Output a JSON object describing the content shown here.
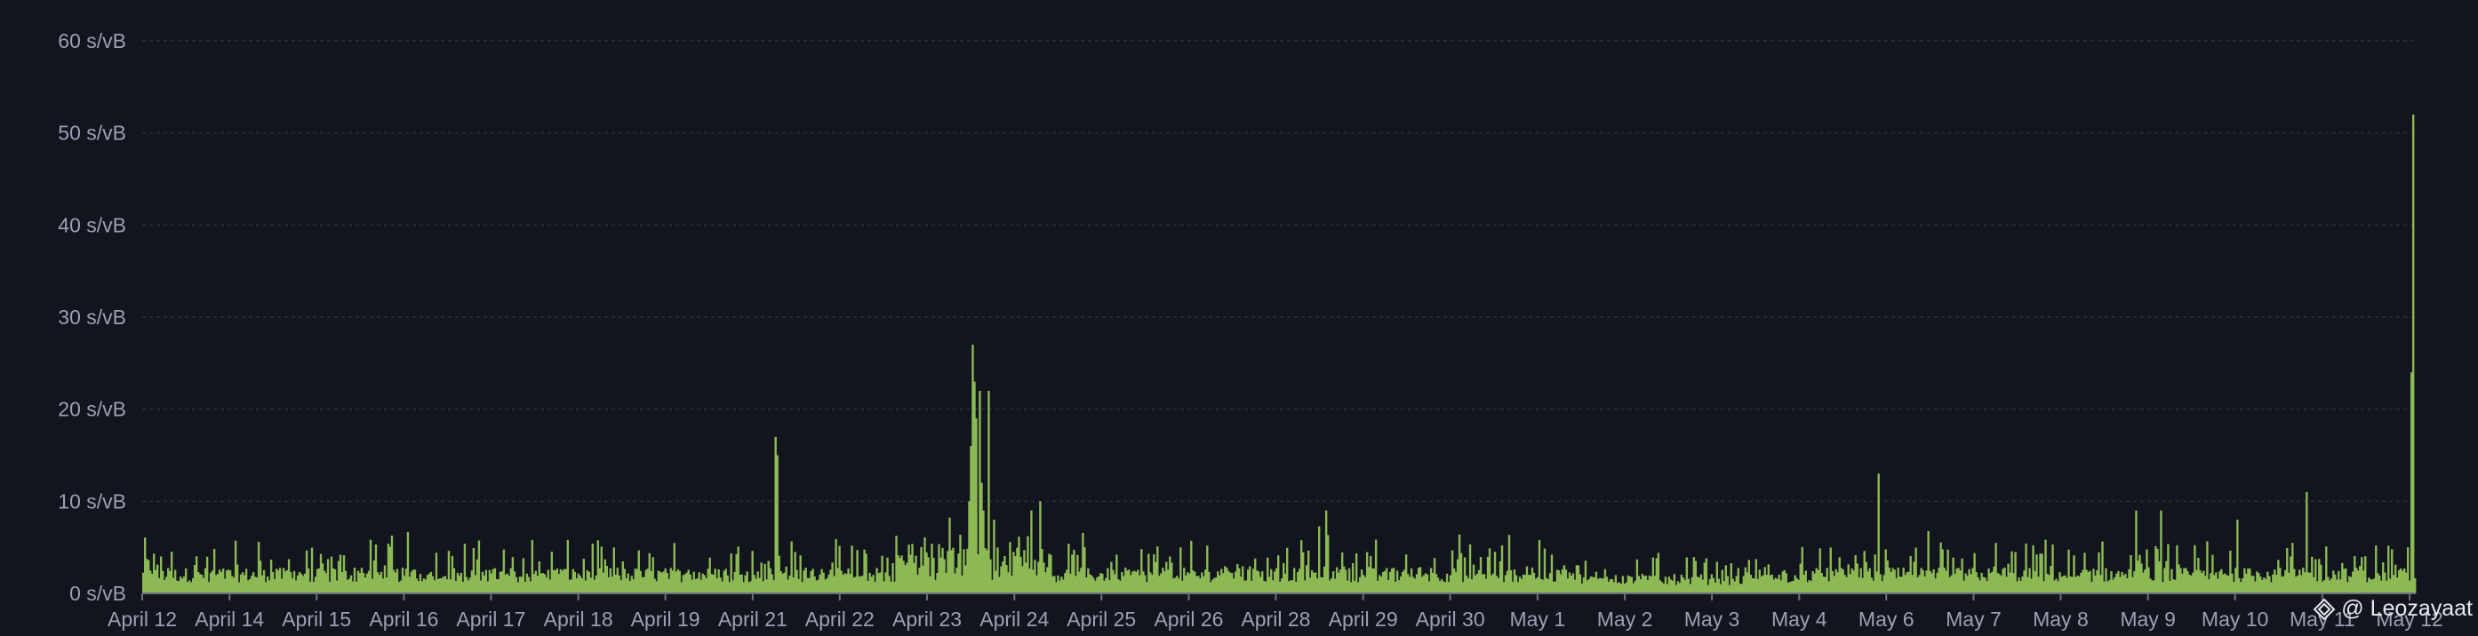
{
  "chart_data": {
    "type": "bar",
    "title": "",
    "xlabel": "",
    "ylabel": "",
    "y_unit": "s/vB",
    "ylim": [
      0,
      60
    ],
    "y_ticks": [
      {
        "value": 0,
        "label": "0 s/vB"
      },
      {
        "value": 10,
        "label": "10 s/vB"
      },
      {
        "value": 20,
        "label": "20 s/vB"
      },
      {
        "value": 30,
        "label": "30 s/vB"
      },
      {
        "value": 40,
        "label": "40 s/vB"
      },
      {
        "value": 50,
        "label": "50 s/vB"
      },
      {
        "value": 60,
        "label": "60 s/vB"
      }
    ],
    "x_ticks": [
      {
        "pos": 0.0,
        "label": "April 12"
      },
      {
        "pos": 0.0384,
        "label": "April 14"
      },
      {
        "pos": 0.0767,
        "label": "April 15"
      },
      {
        "pos": 0.1151,
        "label": "April 16"
      },
      {
        "pos": 0.1534,
        "label": "April 17"
      },
      {
        "pos": 0.1918,
        "label": "April 18"
      },
      {
        "pos": 0.2301,
        "label": "April 19"
      },
      {
        "pos": 0.2685,
        "label": "April 21"
      },
      {
        "pos": 0.3068,
        "label": "April 22"
      },
      {
        "pos": 0.3452,
        "label": "April 23"
      },
      {
        "pos": 0.3836,
        "label": "April 24"
      },
      {
        "pos": 0.4219,
        "label": "April 25"
      },
      {
        "pos": 0.4603,
        "label": "April 26"
      },
      {
        "pos": 0.4986,
        "label": "April 28"
      },
      {
        "pos": 0.537,
        "label": "April 29"
      },
      {
        "pos": 0.5753,
        "label": "April 30"
      },
      {
        "pos": 0.6137,
        "label": "May 1"
      },
      {
        "pos": 0.6521,
        "label": "May 2"
      },
      {
        "pos": 0.6904,
        "label": "May 3"
      },
      {
        "pos": 0.7288,
        "label": "May 4"
      },
      {
        "pos": 0.7671,
        "label": "May 6"
      },
      {
        "pos": 0.8055,
        "label": "May 7"
      },
      {
        "pos": 0.8438,
        "label": "May 8"
      },
      {
        "pos": 0.8822,
        "label": "May 9"
      },
      {
        "pos": 0.9205,
        "label": "May 10"
      },
      {
        "pos": 0.9589,
        "label": "May 11"
      },
      {
        "pos": 0.9973,
        "label": "May 12"
      }
    ],
    "series": [
      {
        "color": "#8cb954",
        "baseline": 1.2,
        "noise_amplitude": 4,
        "spikes": [
          {
            "pos": 0.2782,
            "value": 17
          },
          {
            "pos": 0.279,
            "value": 15
          },
          {
            "pos": 0.3632,
            "value": 10
          },
          {
            "pos": 0.3645,
            "value": 16
          },
          {
            "pos": 0.3655,
            "value": 27
          },
          {
            "pos": 0.3662,
            "value": 23
          },
          {
            "pos": 0.367,
            "value": 19
          },
          {
            "pos": 0.368,
            "value": 22
          },
          {
            "pos": 0.369,
            "value": 12
          },
          {
            "pos": 0.37,
            "value": 9
          },
          {
            "pos": 0.3725,
            "value": 22
          },
          {
            "pos": 0.3745,
            "value": 8
          },
          {
            "pos": 0.3908,
            "value": 9
          },
          {
            "pos": 0.395,
            "value": 10
          },
          {
            "pos": 0.5205,
            "value": 9
          },
          {
            "pos": 0.7642,
            "value": 13
          },
          {
            "pos": 0.8775,
            "value": 9
          },
          {
            "pos": 0.888,
            "value": 9
          },
          {
            "pos": 0.922,
            "value": 8
          },
          {
            "pos": 0.9522,
            "value": 11
          },
          {
            "pos": 0.9965,
            "value": 5
          },
          {
            "pos": 0.9985,
            "value": 24
          },
          {
            "pos": 0.9995,
            "value": 52
          }
        ]
      }
    ],
    "grid": true,
    "legend": "none"
  },
  "watermark": {
    "icon": "bitcoin-diamond-icon",
    "text": "@ Leozayaat"
  }
}
